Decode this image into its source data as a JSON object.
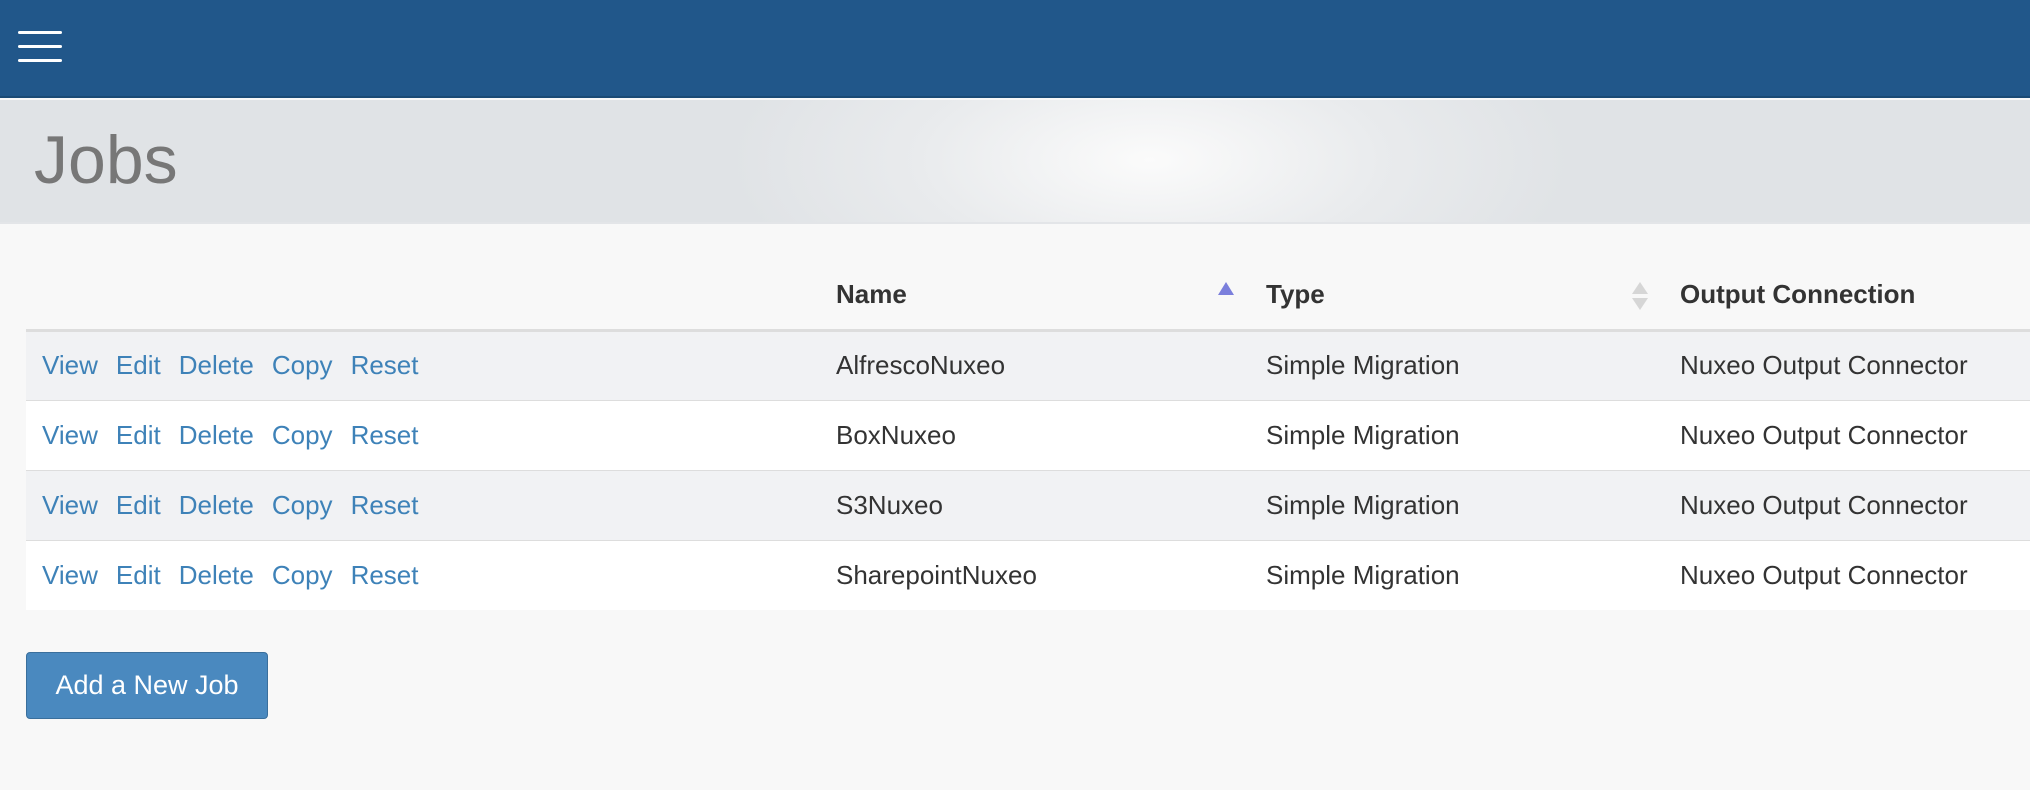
{
  "page": {
    "title": "Jobs"
  },
  "navbar": {
    "menu_icon": "hamburger-menu-icon"
  },
  "table": {
    "columns": [
      "",
      "Name",
      "Type",
      "Output Connection"
    ],
    "sort": {
      "column": "Name",
      "direction": "ascending"
    },
    "action_labels": [
      "View",
      "Edit",
      "Delete",
      "Copy",
      "Reset"
    ],
    "rows": [
      {
        "name": "AlfrescoNuxeo",
        "type": "Simple Migration",
        "output_connection": "Nuxeo Output Connector"
      },
      {
        "name": "BoxNuxeo",
        "type": "Simple Migration",
        "output_connection": "Nuxeo Output Connector"
      },
      {
        "name": "S3Nuxeo",
        "type": "Simple Migration",
        "output_connection": "Nuxeo Output Connector"
      },
      {
        "name": "SharepointNuxeo",
        "type": "Simple Migration",
        "output_connection": "Nuxeo Output Connector"
      }
    ]
  },
  "buttons": {
    "add_job": "Add a New Job"
  },
  "colors": {
    "navbar": "#21578a",
    "link": "#3e82b8",
    "button": "#4a89bf",
    "sort_active": "#7b7fdc"
  }
}
